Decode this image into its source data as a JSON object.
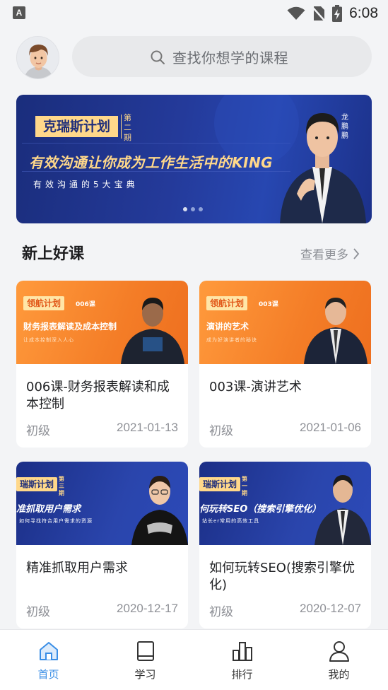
{
  "status_bar": {
    "time": "6:08",
    "app_badge": "A"
  },
  "header": {
    "search_placeholder": "查找你想学的课程"
  },
  "banner": {
    "tag": "克瑞斯计划",
    "phase": "第二期",
    "title": "有效沟通让你成为工作生活中的KING",
    "subtitle": "有效沟通的5大宝典",
    "speaker": "龙鹏鹏"
  },
  "section": {
    "title": "新上好课",
    "more_label": "查看更多"
  },
  "courses": [
    {
      "thumb_tag": "领航计划",
      "thumb_no": "006课",
      "thumb_title": "财务报表解读及成本控制",
      "thumb_sub": "让成本控制深入人心",
      "title": "006课-财务报表解读和成本控制",
      "level": "初级",
      "date": "2021-01-13"
    },
    {
      "thumb_tag": "领航计划",
      "thumb_no": "003课",
      "thumb_title": "演讲的艺术",
      "thumb_sub": "成为好演讲者的秘诀",
      "title": "003课-演讲艺术",
      "level": "初级",
      "date": "2021-01-06"
    },
    {
      "thumb_tag": "瑞斯计划",
      "thumb_no": "第三期",
      "thumb_title": "准抓取用户需求",
      "thumb_sub": "如何寻找符合用户需求的资源",
      "title": "精准抓取用户需求",
      "level": "初级",
      "date": "2020-12-17"
    },
    {
      "thumb_tag": "瑞斯计划",
      "thumb_no": "第一期",
      "thumb_title": "何玩转SEO（搜索引擎优化）",
      "thumb_sub": "站长er常用的高效工具",
      "title": "如何玩转SEO(搜索引擎优化)",
      "level": "初级",
      "date": "2020-12-07"
    }
  ],
  "tabs": [
    {
      "label": "首页",
      "icon": "home-icon",
      "active": true
    },
    {
      "label": "学习",
      "icon": "book-icon",
      "active": false
    },
    {
      "label": "排行",
      "icon": "ranking-icon",
      "active": false
    },
    {
      "label": "我的",
      "icon": "user-icon",
      "active": false
    }
  ],
  "colors": {
    "accent": "#3a8ee6",
    "banner_bg": "#243a9a",
    "banner_gold": "#ffd88a",
    "orange_thumb": "#f47d27"
  }
}
